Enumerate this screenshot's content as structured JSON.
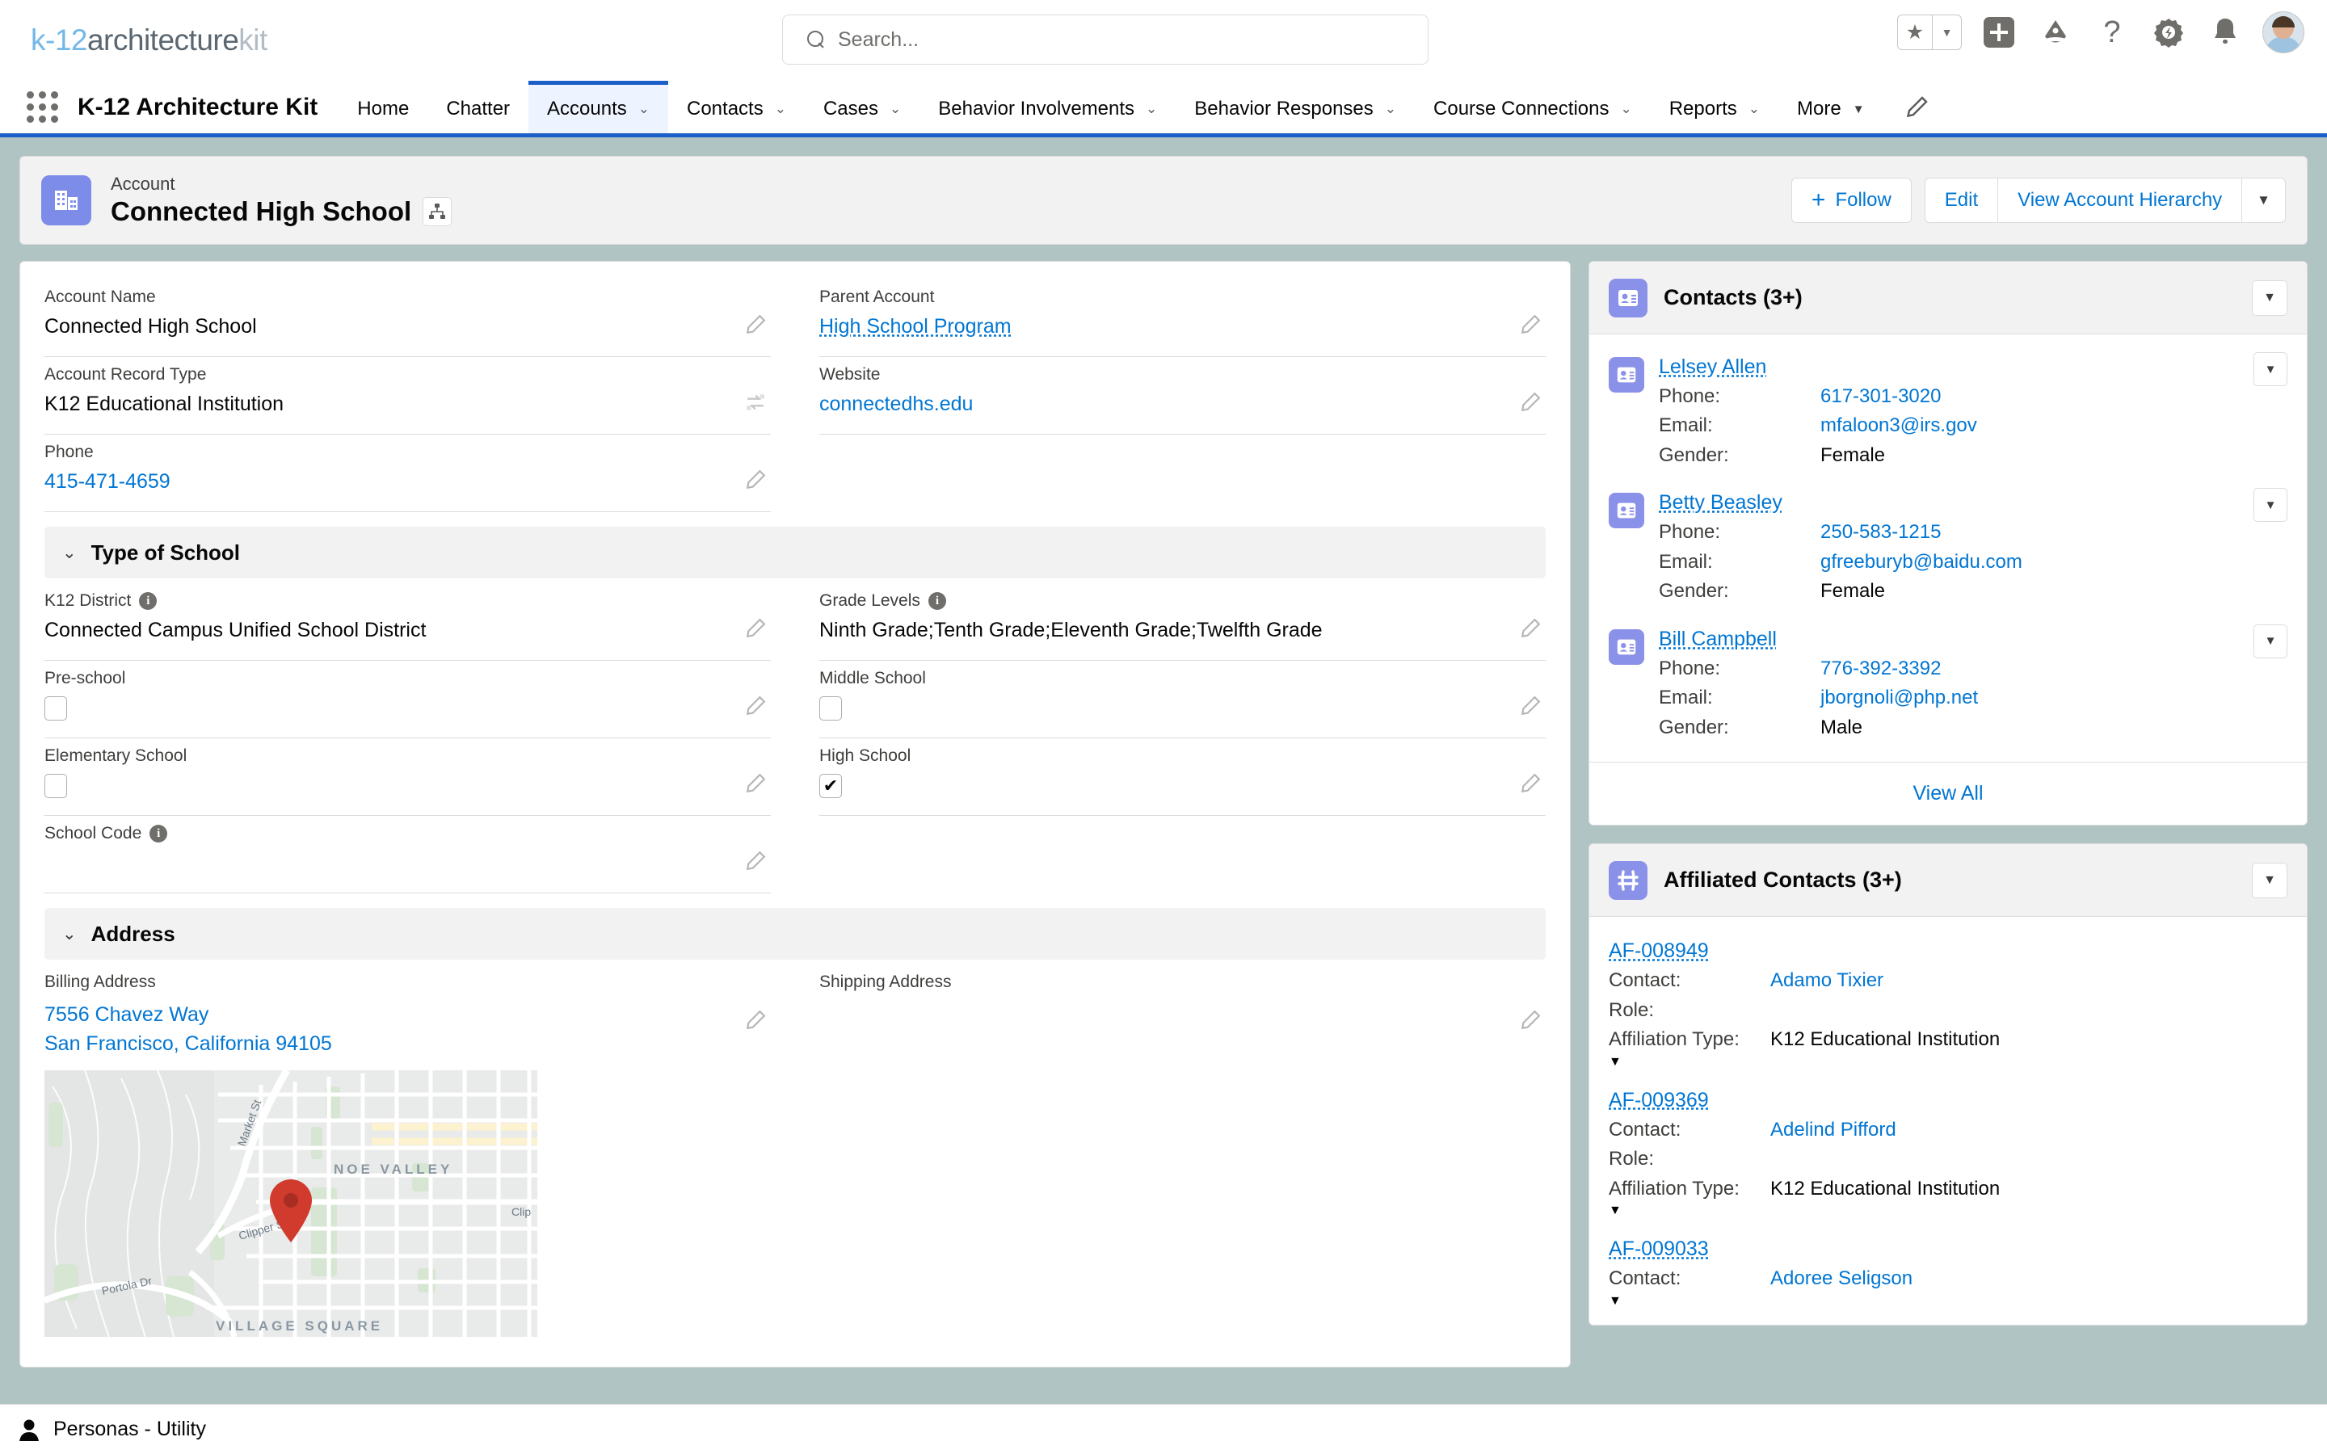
{
  "topbar": {
    "logo": {
      "part1": "k-12",
      "part2": "architecture",
      "part3": "kit"
    },
    "search": {
      "placeholder": "Search...",
      "value": ""
    },
    "icons": [
      "favorites-star",
      "favorites-caret",
      "add",
      "trailhead",
      "help",
      "setup",
      "notifications",
      "avatar"
    ]
  },
  "nav": {
    "app_name": "K-12 Architecture Kit",
    "items": [
      {
        "label": "Home",
        "has_caret": false,
        "active": false
      },
      {
        "label": "Chatter",
        "has_caret": false,
        "active": false
      },
      {
        "label": "Accounts",
        "has_caret": true,
        "active": true
      },
      {
        "label": "Contacts",
        "has_caret": true,
        "active": false
      },
      {
        "label": "Cases",
        "has_caret": true,
        "active": false
      },
      {
        "label": "Behavior Involvements",
        "has_caret": true,
        "active": false
      },
      {
        "label": "Behavior Responses",
        "has_caret": true,
        "active": false
      },
      {
        "label": "Course Connections",
        "has_caret": true,
        "active": false
      },
      {
        "label": "Reports",
        "has_caret": true,
        "active": false
      },
      {
        "label": "More",
        "has_caret": true,
        "active": false
      }
    ]
  },
  "record_header": {
    "object_label": "Account",
    "record_name": "Connected High School",
    "actions": {
      "follow": "Follow",
      "edit": "Edit",
      "view_hierarchy": "View Account Hierarchy"
    }
  },
  "details": {
    "fields_left": [
      {
        "label": "Account Name",
        "value": "Connected High School",
        "type": "text",
        "edit": "pencil"
      },
      {
        "label": "Account Record Type",
        "value": "K12 Educational Institution",
        "type": "text",
        "edit": "change-record-type"
      },
      {
        "label": "Phone",
        "value": "415-471-4659",
        "type": "link",
        "edit": "pencil"
      }
    ],
    "fields_right": [
      {
        "label": "Parent Account",
        "value": "High School Program",
        "type": "link-dotted",
        "edit": "pencil"
      },
      {
        "label": "Website",
        "value": "connectedhs.edu",
        "type": "link",
        "edit": "pencil"
      }
    ],
    "sections": [
      {
        "title": "Type of School",
        "fields_left": [
          {
            "label": "K12 District",
            "value": "Connected Campus Unified School District",
            "type": "text",
            "info": true,
            "edit": "pencil"
          },
          {
            "label": "Pre-school",
            "value": "",
            "type": "checkbox",
            "checked": false,
            "edit": "pencil"
          },
          {
            "label": "Elementary School",
            "value": "",
            "type": "checkbox",
            "checked": false,
            "edit": "pencil"
          },
          {
            "label": "School Code",
            "value": "",
            "type": "text",
            "info": true,
            "edit": "pencil"
          }
        ],
        "fields_right": [
          {
            "label": "Grade Levels",
            "value": "Ninth Grade;Tenth Grade;Eleventh Grade;Twelfth Grade",
            "type": "text",
            "info": true,
            "edit": "pencil"
          },
          {
            "label": "Middle School",
            "value": "",
            "type": "checkbox",
            "checked": false,
            "edit": "pencil"
          },
          {
            "label": "High School",
            "value": "",
            "type": "checkbox",
            "checked": true,
            "edit": "pencil"
          }
        ]
      },
      {
        "title": "Address",
        "fields_left": [
          {
            "label": "Billing Address",
            "line1": "7556 Chavez Way",
            "line2": "San Francisco, California 94105",
            "type": "address",
            "edit": "pencil"
          }
        ],
        "fields_right": [
          {
            "label": "Shipping Address",
            "value": "",
            "type": "address-empty",
            "edit": "pencil"
          }
        ]
      }
    ]
  },
  "map": {
    "labels": {
      "market_st": "Market St",
      "clipper_st": "Clipper St",
      "portola_dr": "Portola Dr",
      "noe_valley": "NOE VALLEY",
      "village_square": "VILLAGE SQUARE",
      "clip": "Clip"
    },
    "pin_color": "#d03b2e"
  },
  "contacts_card": {
    "title": "Contacts (3+)",
    "icon": "contact-card-icon",
    "view_all": "View All",
    "labels": {
      "phone": "Phone:",
      "email": "Email:",
      "gender": "Gender:"
    },
    "rows": [
      {
        "name": "Lelsey Allen",
        "phone": "617-301-3020",
        "email": "mfaloon3@irs.gov",
        "gender": "Female"
      },
      {
        "name": "Betty Beasley",
        "phone": "250-583-1215",
        "email": "gfreeburyb@baidu.com",
        "gender": "Female"
      },
      {
        "name": "Bill Campbell",
        "phone": "776-392-3392",
        "email": "jborgnoli@php.net",
        "gender": "Male"
      }
    ]
  },
  "affiliated_card": {
    "title": "Affiliated Contacts (3+)",
    "icon": "affiliation-icon",
    "labels": {
      "contact": "Contact:",
      "role": "Role:",
      "affiliation_type": "Affiliation Type:"
    },
    "rows": [
      {
        "id": "AF-008949",
        "contact": "Adamo Tixier",
        "role": "",
        "affiliation_type": "K12 Educational Institution"
      },
      {
        "id": "AF-009369",
        "contact": "Adelind Pifford",
        "role": "",
        "affiliation_type": "K12 Educational Institution"
      },
      {
        "id": "AF-009033",
        "contact": "Adoree Seligson",
        "role": "",
        "affiliation_type": ""
      }
    ]
  },
  "utility_bar": {
    "label": "Personas - Utility",
    "icon": "person-icon"
  },
  "colors": {
    "brand_blue": "#1b5ec7",
    "link_blue": "#0176d3",
    "purple_icon": "#7c8ce8",
    "page_bg": "#b0c4c4",
    "panel_bg": "#f3f2f2"
  }
}
